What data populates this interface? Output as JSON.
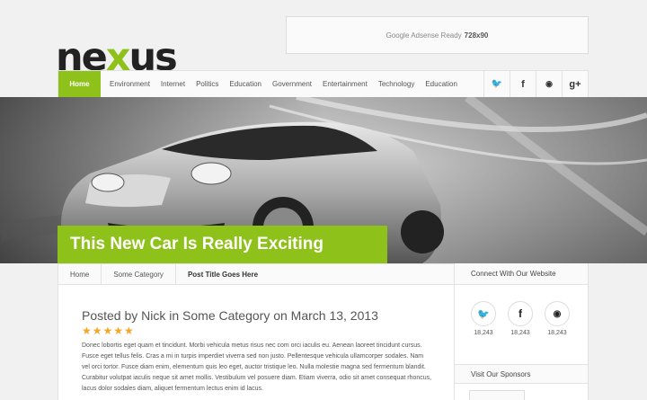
{
  "header": {
    "logo_prefix": "ne",
    "logo_x": "x",
    "logo_suffix": "us",
    "ad_text": "Google Adsense Ready",
    "ad_size": "728x90"
  },
  "nav": {
    "items": [
      "Home",
      "Environment",
      "Internet",
      "Politics",
      "Education",
      "Government",
      "Entertainment",
      "Technology",
      "Education"
    ],
    "social_icons": [
      "twitter-icon",
      "facebook-icon",
      "rss-icon",
      "google-plus-icon"
    ],
    "social_glyphs": [
      "🐦",
      "f",
      "◉",
      "g+"
    ]
  },
  "hero": {
    "title": "This New Car Is Really Exciting"
  },
  "breadcrumb": [
    "Home",
    "Some Category",
    "Post Title Goes Here"
  ],
  "post": {
    "meta": "Posted by Nick in Some Category on March 13, 2013",
    "stars": "★★★★★",
    "rating": 5,
    "body": "Donec lobortis eget quam et tincidunt. Morbi vehicula metus risus nec com orci iaculis eu. Aenean laoreet tincidunt cursus. Fusce eget tellus felis. Cras a mi in turpis imperdiet viverra sed non justo. Pellentesque vehicula ullamcorper sodales. Nam vel orci tortor. Fusce diam enim, elementum quis leo eget, auctor tristique leo. Nulla molestie magna sed fermentum blandit. Curabitur volutpat iaculis neque sit amet mollis. Vestibulum vel posuere diam. Etiam viverra, odio sit amet consequat rhoncus, lacus dolor sodales diam, aliquet fermentum lectus enim id lacus."
  },
  "sidebar": {
    "connect_title": "Connect With Our Website",
    "counts": [
      {
        "icon": "twitter-icon",
        "glyph": "🐦",
        "value": "18,243",
        "color": "#29a9e1"
      },
      {
        "icon": "facebook-icon",
        "glyph": "f",
        "value": "18,243",
        "color": "#222222"
      },
      {
        "icon": "rss-icon",
        "glyph": "◉",
        "value": "18,243",
        "color": "#222222"
      }
    ],
    "sponsors_title": "Visit Our Sponsors"
  },
  "colors": {
    "accent": "#8ec21b"
  }
}
